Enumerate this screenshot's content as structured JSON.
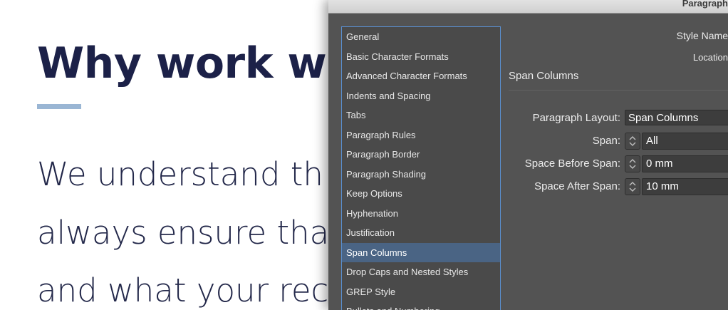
{
  "web": {
    "heading": "Why work wit",
    "lines": [
      "We understand th",
      "always ensure tha",
      "and what your rec"
    ]
  },
  "dialog": {
    "title": "Paragraph",
    "categories": [
      {
        "label": "General"
      },
      {
        "label": "Basic Character Formats"
      },
      {
        "label": "Advanced Character Formats"
      },
      {
        "label": "Indents and Spacing"
      },
      {
        "label": "Tabs"
      },
      {
        "label": "Paragraph Rules"
      },
      {
        "label": "Paragraph Border"
      },
      {
        "label": "Paragraph Shading"
      },
      {
        "label": "Keep Options"
      },
      {
        "label": "Hyphenation"
      },
      {
        "label": "Justification"
      },
      {
        "label": "Span Columns"
      },
      {
        "label": "Drop Caps and Nested Styles"
      },
      {
        "label": "GREP Style"
      },
      {
        "label": "Bullets and Numbering"
      }
    ],
    "selected_category": "Span Columns",
    "style_name_label": "Style Name",
    "location_label": "Location",
    "section_title": "Span Columns",
    "fields": {
      "paragraph_layout": {
        "label": "Paragraph Layout:",
        "value": "Span Columns"
      },
      "span": {
        "label": "Span:",
        "value": "All"
      },
      "space_before": {
        "label": "Space Before Span:",
        "value": "0 mm"
      },
      "space_after": {
        "label": "Space After Span:",
        "value": "10 mm"
      }
    }
  },
  "colors": {
    "dialog_bg": "#535353",
    "list_bg": "#4a4a4a",
    "selection": "#4a6484",
    "heading": "#1c2148",
    "accent_underline": "#9ab6d4"
  }
}
